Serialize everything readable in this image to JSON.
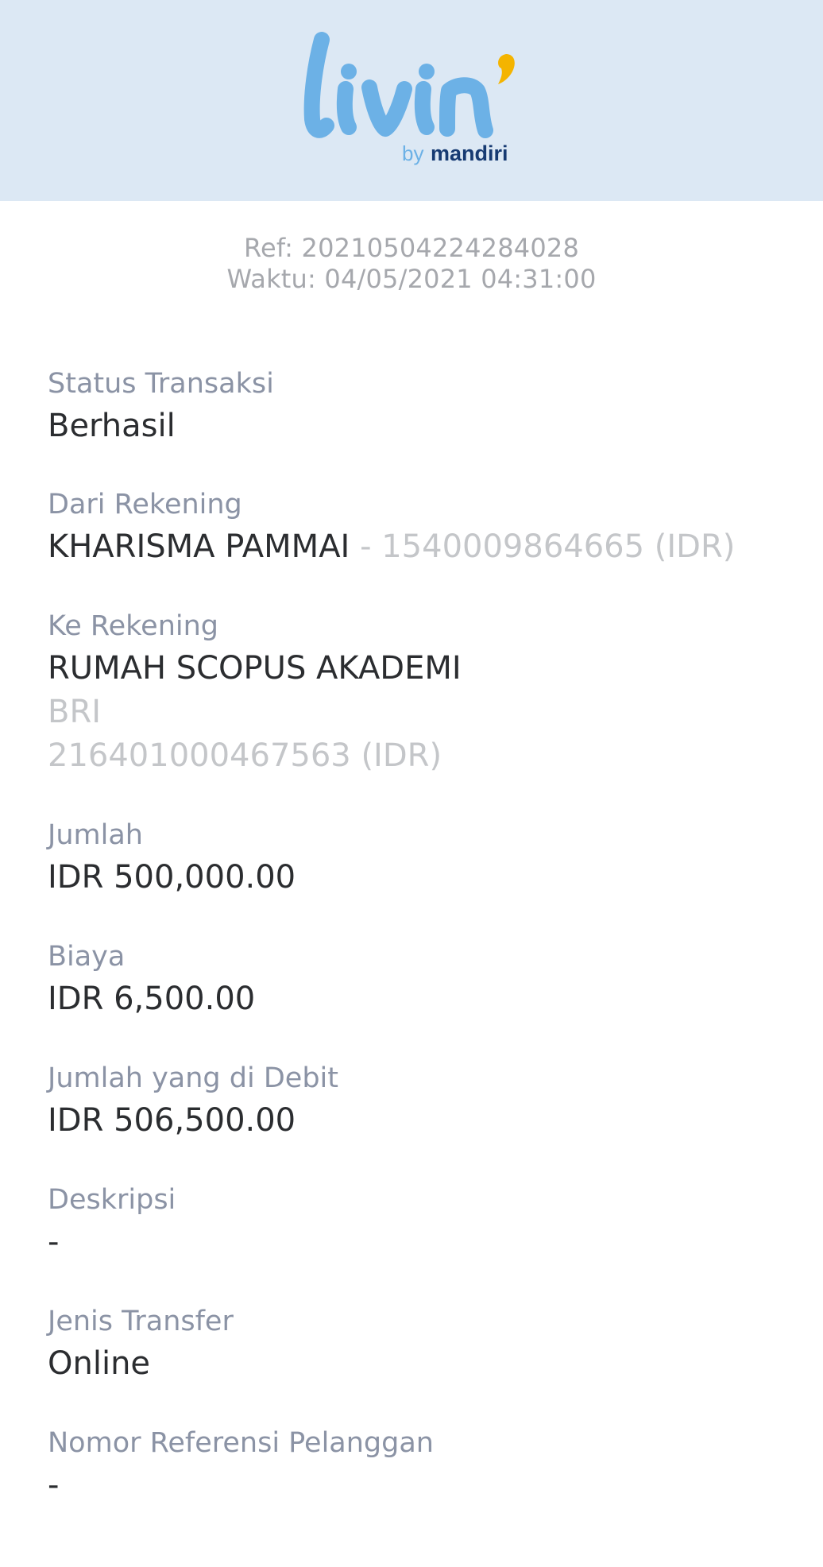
{
  "brand": {
    "logo_word": "livin'",
    "by_text": "by",
    "bank_text": "mandiri",
    "colors": {
      "header_bg": "#dce8f4",
      "logo_blue": "#6cb1e6",
      "logo_accent": "#f4b400",
      "mandiri_navy": "#163a72"
    }
  },
  "receipt": {
    "ref": "Ref: 20210504224284028",
    "time": "Waktu: 04/05/2021 04:31:00"
  },
  "fields": {
    "status": {
      "label": "Status Transaksi",
      "value": "Berhasil"
    },
    "from_account": {
      "label": "Dari Rekening",
      "name": "KHARISMA PAMMAI",
      "number": " - 1540009864665 (IDR)"
    },
    "to_account": {
      "label": "Ke Rekening",
      "name": "RUMAH SCOPUS AKADEMI",
      "bank": "BRI",
      "number": "216401000467563 (IDR)"
    },
    "amount": {
      "label": "Jumlah",
      "value": "IDR 500,000.00"
    },
    "fee": {
      "label": "Biaya",
      "value": "IDR 6,500.00"
    },
    "debited": {
      "label": "Jumlah yang di Debit",
      "value": "IDR 506,500.00"
    },
    "description": {
      "label": "Deskripsi",
      "value": "-"
    },
    "transfer_type": {
      "label": "Jenis Transfer",
      "value": "Online"
    },
    "customer_ref": {
      "label": "Nomor Referensi Pelanggan",
      "value": "-"
    }
  }
}
